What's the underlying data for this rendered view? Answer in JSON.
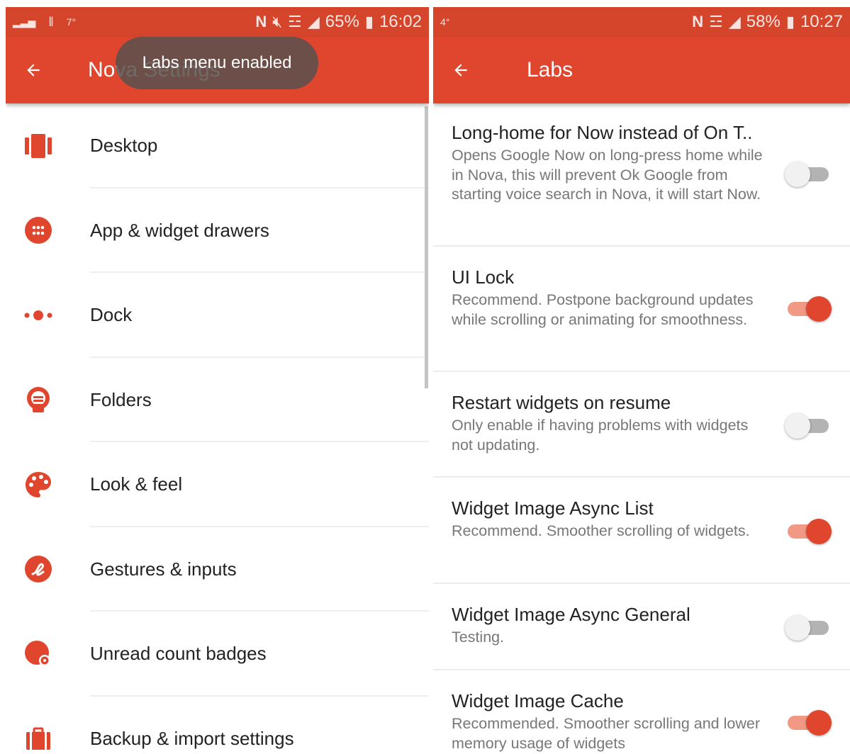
{
  "colors": {
    "accent": "#e0462d",
    "status_bar": "#d5452c",
    "switch_on_track": "#f29986",
    "switch_off_track": "#b3b3b3"
  },
  "left": {
    "status": {
      "left_text": "7°",
      "battery": "65%",
      "time": "16:02"
    },
    "title": "Nova Settings",
    "toast": "Labs menu enabled",
    "items": [
      {
        "label": "Desktop",
        "icon": "desktop-icon"
      },
      {
        "label": "App & widget drawers",
        "icon": "app-drawer-icon"
      },
      {
        "label": "Dock",
        "icon": "dock-icon"
      },
      {
        "label": "Folders",
        "icon": "folder-icon"
      },
      {
        "label": "Look & feel",
        "icon": "palette-icon"
      },
      {
        "label": "Gestures & inputs",
        "icon": "gesture-icon"
      },
      {
        "label": "Unread count badges",
        "icon": "badge-icon"
      },
      {
        "label": "Backup & import settings",
        "icon": "backup-icon"
      }
    ]
  },
  "right": {
    "status": {
      "left_text": "4°",
      "battery": "58%",
      "time": "10:27"
    },
    "title": "Labs",
    "settings": [
      {
        "title": "Long-home for Now instead of On T..",
        "desc": "Opens Google Now on long-press home while in Nova, this will prevent Ok Google from starting voice search in Nova, it will start Now.",
        "enabled": false
      },
      {
        "title": "UI Lock",
        "desc": "Recommend. Postpone background updates while scrolling or animating for smoothness.",
        "enabled": true
      },
      {
        "title": "Restart widgets on resume",
        "desc": "Only enable if having problems with widgets not updating.",
        "enabled": false
      },
      {
        "title": "Widget Image Async List",
        "desc": "Recommend. Smoother scrolling of widgets.",
        "enabled": true
      },
      {
        "title": "Widget Image Async General",
        "desc": "Testing.",
        "enabled": false
      },
      {
        "title": "Widget Image Cache",
        "desc": "Recommended. Smoother scrolling and lower memory usage of widgets",
        "enabled": true
      }
    ]
  }
}
